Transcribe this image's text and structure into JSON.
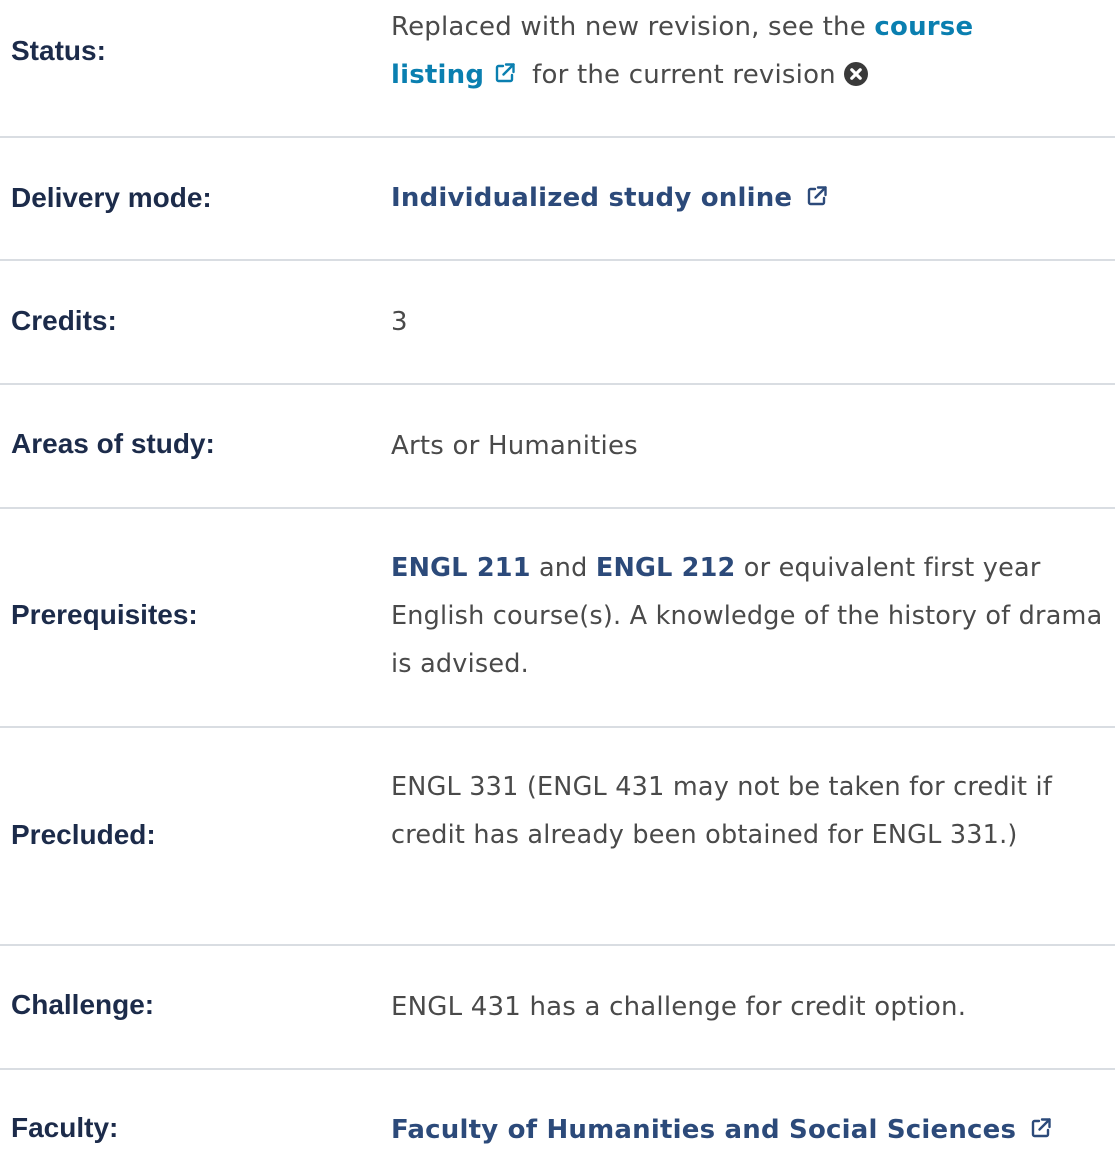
{
  "rows": {
    "status": {
      "label": "Status:",
      "text_before": "Replaced with new revision, see the ",
      "link_word1": "course",
      "link_word2": "listing",
      "text_after": "for the current revision"
    },
    "delivery": {
      "label": "Delivery mode:",
      "link": "Individualized study online"
    },
    "credits": {
      "label": "Credits:",
      "value": "3"
    },
    "areas": {
      "label": "Areas of study:",
      "value": "Arts or Humanities"
    },
    "prerequisites": {
      "label": "Prerequisites:",
      "course1": "ENGL 211",
      "and": " and ",
      "course2": "ENGL 212",
      "rest": " or equivalent first year English course(s). A knowledge of the history of drama is advised."
    },
    "precluded": {
      "label": "Precluded:",
      "value": "ENGL 331 (ENGL 431 may not be taken for credit if credit has already been obtained for ENGL 331.)"
    },
    "challenge": {
      "label": "Challenge:",
      "value": "ENGL 431 has a challenge for credit option."
    },
    "faculty": {
      "label": "Faculty:",
      "link": "Faculty of Humanities and Social Sciences"
    }
  },
  "icons": {
    "external_link": "external-link-icon",
    "close": "times-circle-icon"
  },
  "colors": {
    "label": "#1c2b4a",
    "value_text": "#4a4a4a",
    "link_teal": "#0a7fb0",
    "link_navy": "#2c4a7a",
    "divider": "#d9dde2"
  }
}
